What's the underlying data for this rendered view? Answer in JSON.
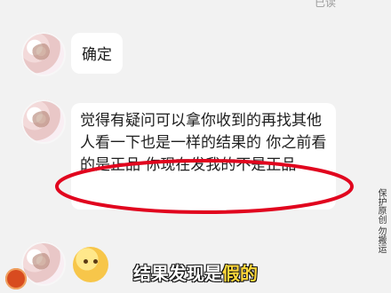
{
  "status": {
    "read_label": "已读"
  },
  "messages": [
    {
      "text": "确定"
    },
    {
      "text": "觉得有疑问可以拿你收到的再找其他人看一下也是一样的结果的 你之前看的是正品 你现在发我的不是正品"
    }
  ],
  "caption": {
    "prefix": "结果发现是",
    "highlight": "假的"
  },
  "watermark": {
    "text": "保护原创 勿搬运"
  },
  "colors": {
    "annotation_oval": "#e1051e",
    "caption_highlight": "#ffd83b"
  },
  "icons": {
    "emoji": "thinking-face-icon",
    "corner": "mascot-icon"
  }
}
